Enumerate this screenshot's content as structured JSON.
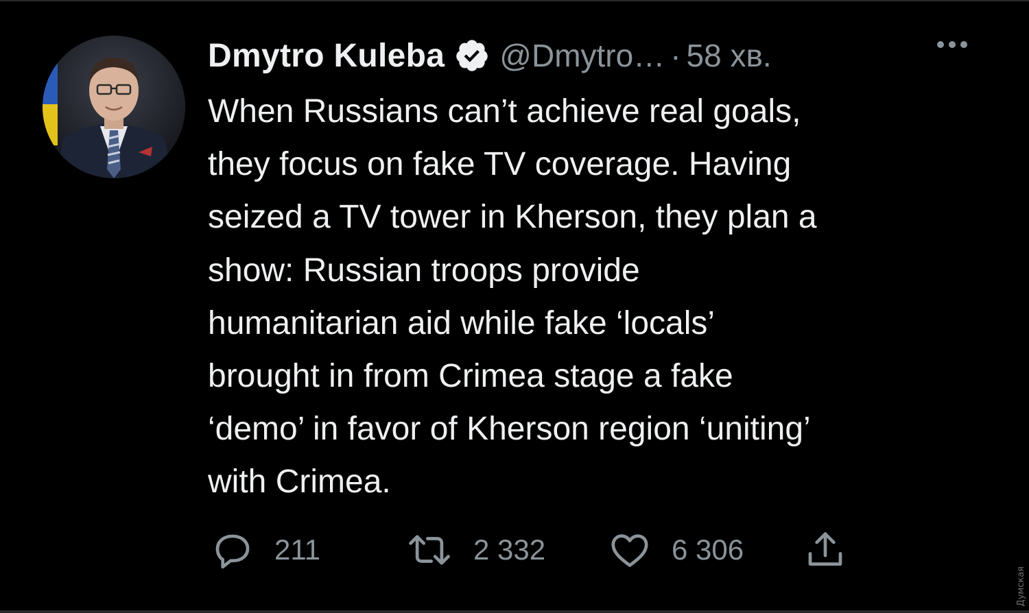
{
  "tweet": {
    "author_name": "Dmytro Kuleba",
    "handle": "@Dmytro…",
    "separator": "·",
    "timestamp": "58 хв.",
    "verified": true,
    "lines": [
      "When Russians can’t achieve real goals,",
      "they focus on fake TV coverage. Having",
      "seized a TV tower in Kherson, they plan a",
      "show: Russian troops provide",
      "humanitarian aid while fake ‘locals’",
      "brought in from Crimea stage a fake",
      "‘demo’ in favor of Kherson region ‘uniting’",
      "with Crimea."
    ]
  },
  "actions": {
    "reply": {
      "icon": "reply-icon",
      "count": "211"
    },
    "retweet": {
      "icon": "retweet-icon",
      "count": "2 332"
    },
    "like": {
      "icon": "heart-icon",
      "count": "6 306"
    },
    "share": {
      "icon": "share-icon"
    }
  },
  "watermark": "Думская",
  "colors": {
    "background": "#000000",
    "text": "#eef0f1",
    "muted": "#8b949a"
  }
}
